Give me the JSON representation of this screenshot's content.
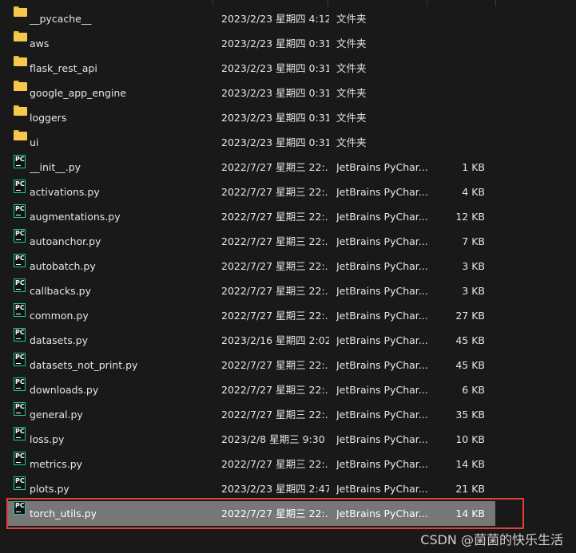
{
  "files": [
    {
      "name": "__pycache__",
      "date": "2023/2/23 星期四 4:12",
      "type": "文件夹",
      "size": "",
      "icon": "folder-icon"
    },
    {
      "name": "aws",
      "date": "2023/2/23 星期四 0:31",
      "type": "文件夹",
      "size": "",
      "icon": "folder-icon"
    },
    {
      "name": "flask_rest_api",
      "date": "2023/2/23 星期四 0:31",
      "type": "文件夹",
      "size": "",
      "icon": "folder-icon"
    },
    {
      "name": "google_app_engine",
      "date": "2023/2/23 星期四 0:31",
      "type": "文件夹",
      "size": "",
      "icon": "folder-icon"
    },
    {
      "name": "loggers",
      "date": "2023/2/23 星期四 0:31",
      "type": "文件夹",
      "size": "",
      "icon": "folder-icon"
    },
    {
      "name": "ui",
      "date": "2023/2/23 星期四 0:31",
      "type": "文件夹",
      "size": "",
      "icon": "folder-icon"
    },
    {
      "name": "__init__.py",
      "date": "2022/7/27 星期三 22:...",
      "type": "JetBrains PyChar...",
      "size": "1 KB",
      "icon": "pycharm-file-icon"
    },
    {
      "name": "activations.py",
      "date": "2022/7/27 星期三 22:...",
      "type": "JetBrains PyChar...",
      "size": "4 KB",
      "icon": "pycharm-file-icon"
    },
    {
      "name": "augmentations.py",
      "date": "2022/7/27 星期三 22:...",
      "type": "JetBrains PyChar...",
      "size": "12 KB",
      "icon": "pycharm-file-icon"
    },
    {
      "name": "autoanchor.py",
      "date": "2022/7/27 星期三 22:...",
      "type": "JetBrains PyChar...",
      "size": "7 KB",
      "icon": "pycharm-file-icon"
    },
    {
      "name": "autobatch.py",
      "date": "2022/7/27 星期三 22:...",
      "type": "JetBrains PyChar...",
      "size": "3 KB",
      "icon": "pycharm-file-icon"
    },
    {
      "name": "callbacks.py",
      "date": "2022/7/27 星期三 22:...",
      "type": "JetBrains PyChar...",
      "size": "3 KB",
      "icon": "pycharm-file-icon"
    },
    {
      "name": "common.py",
      "date": "2022/7/27 星期三 22:...",
      "type": "JetBrains PyChar...",
      "size": "27 KB",
      "icon": "pycharm-file-icon"
    },
    {
      "name": "datasets.py",
      "date": "2023/2/16 星期四 2:02",
      "type": "JetBrains PyChar...",
      "size": "45 KB",
      "icon": "pycharm-file-icon"
    },
    {
      "name": "datasets_not_print.py",
      "date": "2022/7/27 星期三 22:...",
      "type": "JetBrains PyChar...",
      "size": "45 KB",
      "icon": "pycharm-file-icon"
    },
    {
      "name": "downloads.py",
      "date": "2022/7/27 星期三 22:...",
      "type": "JetBrains PyChar...",
      "size": "6 KB",
      "icon": "pycharm-file-icon"
    },
    {
      "name": "general.py",
      "date": "2022/7/27 星期三 22:...",
      "type": "JetBrains PyChar...",
      "size": "35 KB",
      "icon": "pycharm-file-icon"
    },
    {
      "name": "loss.py",
      "date": "2023/2/8 星期三 9:30",
      "type": "JetBrains PyChar...",
      "size": "10 KB",
      "icon": "pycharm-file-icon"
    },
    {
      "name": "metrics.py",
      "date": "2022/7/27 星期三 22:...",
      "type": "JetBrains PyChar...",
      "size": "14 KB",
      "icon": "pycharm-file-icon"
    },
    {
      "name": "plots.py",
      "date": "2023/2/23 星期四 2:47",
      "type": "JetBrains PyChar...",
      "size": "21 KB",
      "icon": "pycharm-file-icon"
    },
    {
      "name": "torch_utils.py",
      "date": "2022/7/27 星期三 22:...",
      "type": "JetBrains PyChar...",
      "size": "14 KB",
      "icon": "pycharm-file-icon",
      "selected": true
    }
  ],
  "pycharm_icon_text": "PC",
  "watermark": "CSDN @菌菌的快乐生活",
  "colors": {
    "background": "#191919",
    "selected_row": "#777777",
    "highlight_border": "#e0403a",
    "folder": "#f6c84c",
    "pycharm_icon_border": "#18c9a0"
  }
}
